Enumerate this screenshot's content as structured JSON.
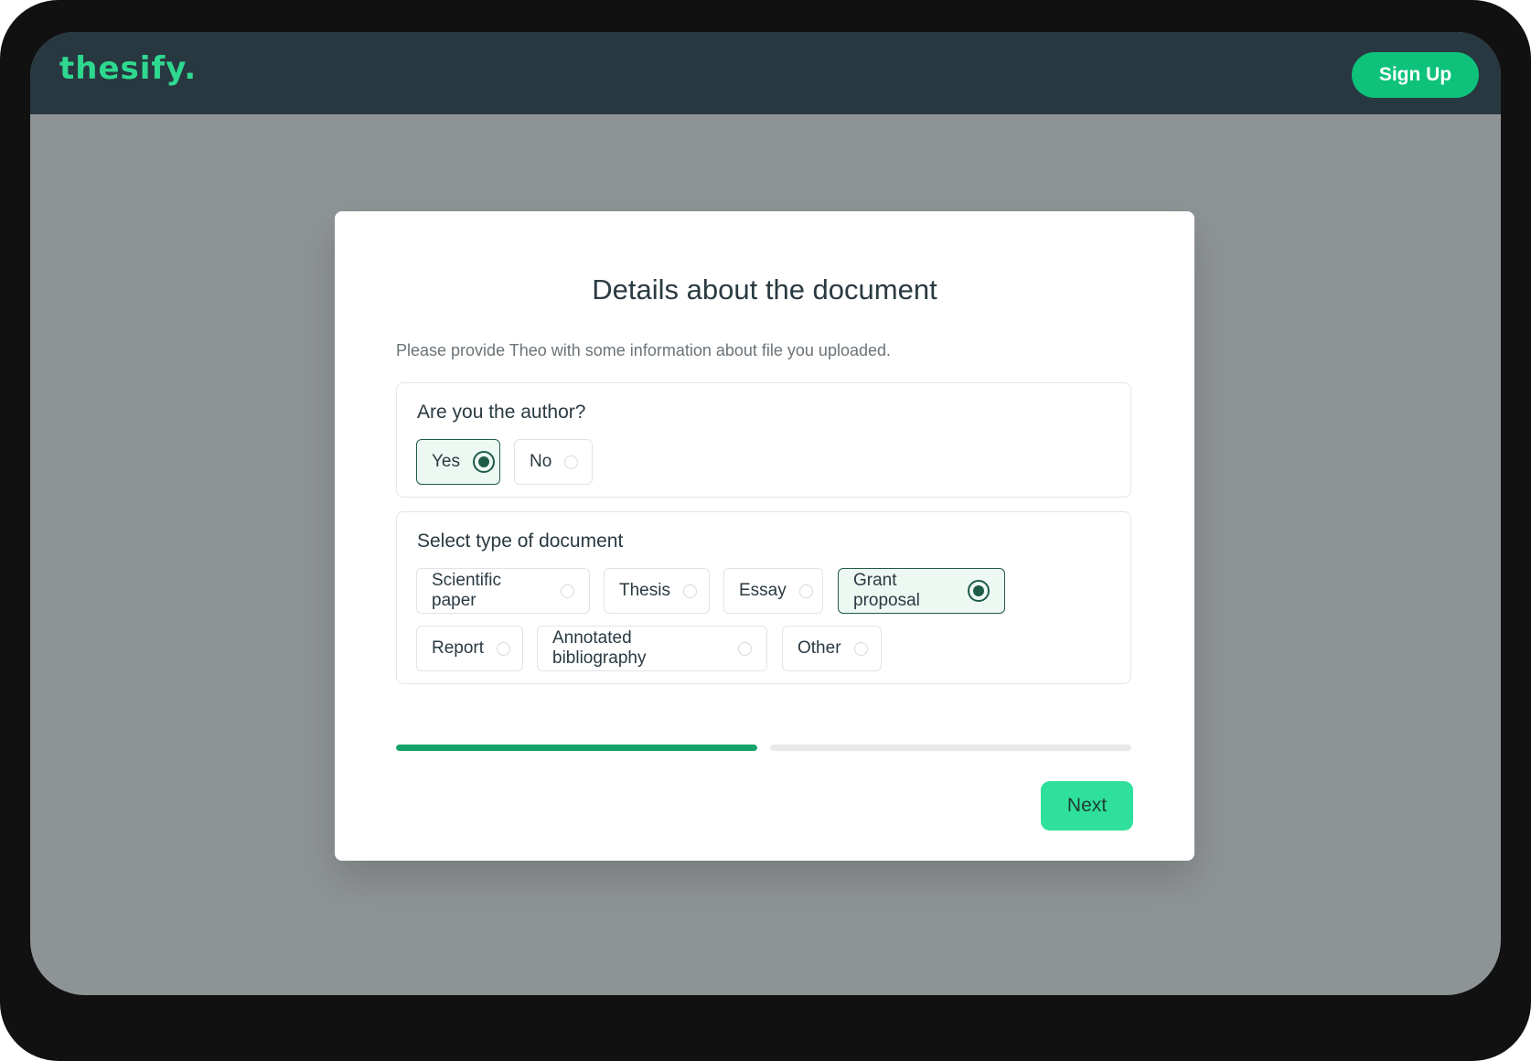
{
  "app": {
    "logo_text": "thesify.",
    "brand_color": "#2ed98f",
    "signup_label": "Sign Up"
  },
  "dialog": {
    "title": "Details about the document",
    "subtitle": "Please provide Theo with some information about file you uploaded.",
    "author_question": {
      "label": "Are you the author?",
      "options": [
        {
          "label": "Yes",
          "selected": true
        },
        {
          "label": "No",
          "selected": false
        }
      ]
    },
    "doc_type": {
      "label": "Select type of document",
      "options": [
        {
          "label": "Scientific paper",
          "selected": false
        },
        {
          "label": "Thesis",
          "selected": false
        },
        {
          "label": "Essay",
          "selected": false
        },
        {
          "label": "Grant proposal",
          "selected": true
        },
        {
          "label": "Report",
          "selected": false
        },
        {
          "label": "Annotated bibliography",
          "selected": false
        },
        {
          "label": "Other",
          "selected": false
        }
      ]
    },
    "progress": {
      "current_step": 1,
      "total_steps": 2
    },
    "next_label": "Next"
  },
  "colors": {
    "selected_border": "#1e5c48",
    "progress_fill": "#13a36b",
    "next_button": "#2ee09b",
    "signup_button": "#0ec27b",
    "navbar": "#283840"
  }
}
